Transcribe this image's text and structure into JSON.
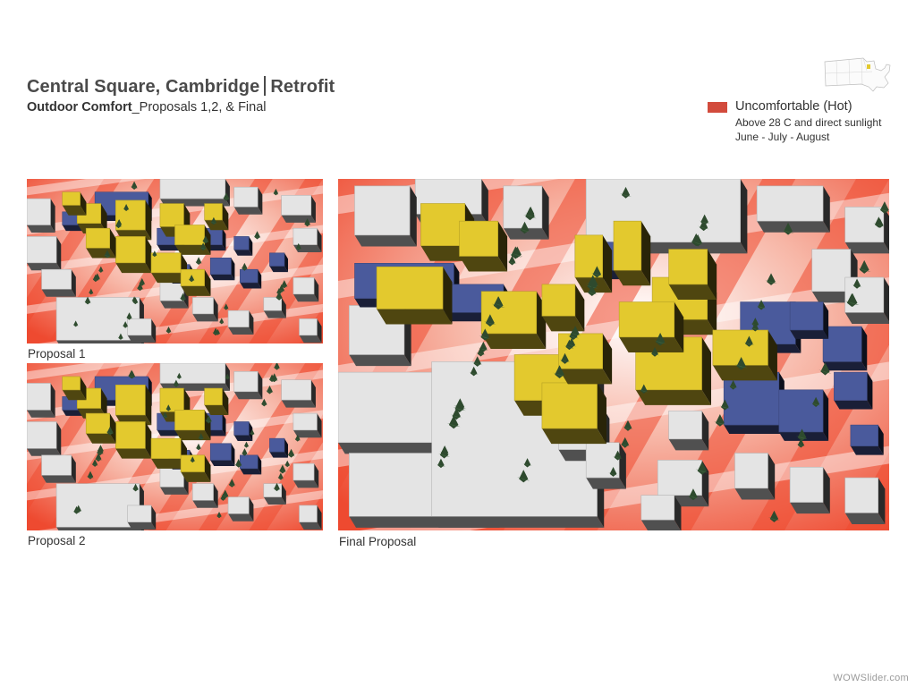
{
  "header": {
    "title_main": "Central Square, Cambridge",
    "title_suffix": "Retrofit",
    "subtitle_bold": "Outdoor Comfort",
    "subtitle_rest": "_Proposals 1,2, & Final"
  },
  "legend": {
    "label": "Uncomfortable (Hot)",
    "line1": "Above 28 C and direct sunlight",
    "line2": "June - July - August",
    "color": "#d24b3c"
  },
  "panels": [
    {
      "id": "p1",
      "caption": "Proposal 1"
    },
    {
      "id": "p2",
      "caption": "Proposal 2"
    },
    {
      "id": "final",
      "caption": "Final Proposal"
    }
  ],
  "colors": {
    "heat": "#ee4a30",
    "existing_building": "#e4e4e4",
    "proposed_tower": "#e3c92e",
    "proposed_lowrise": "#4a5a9c",
    "tree": "#2e4a2e"
  },
  "watermark": "WOWSlider.com"
}
